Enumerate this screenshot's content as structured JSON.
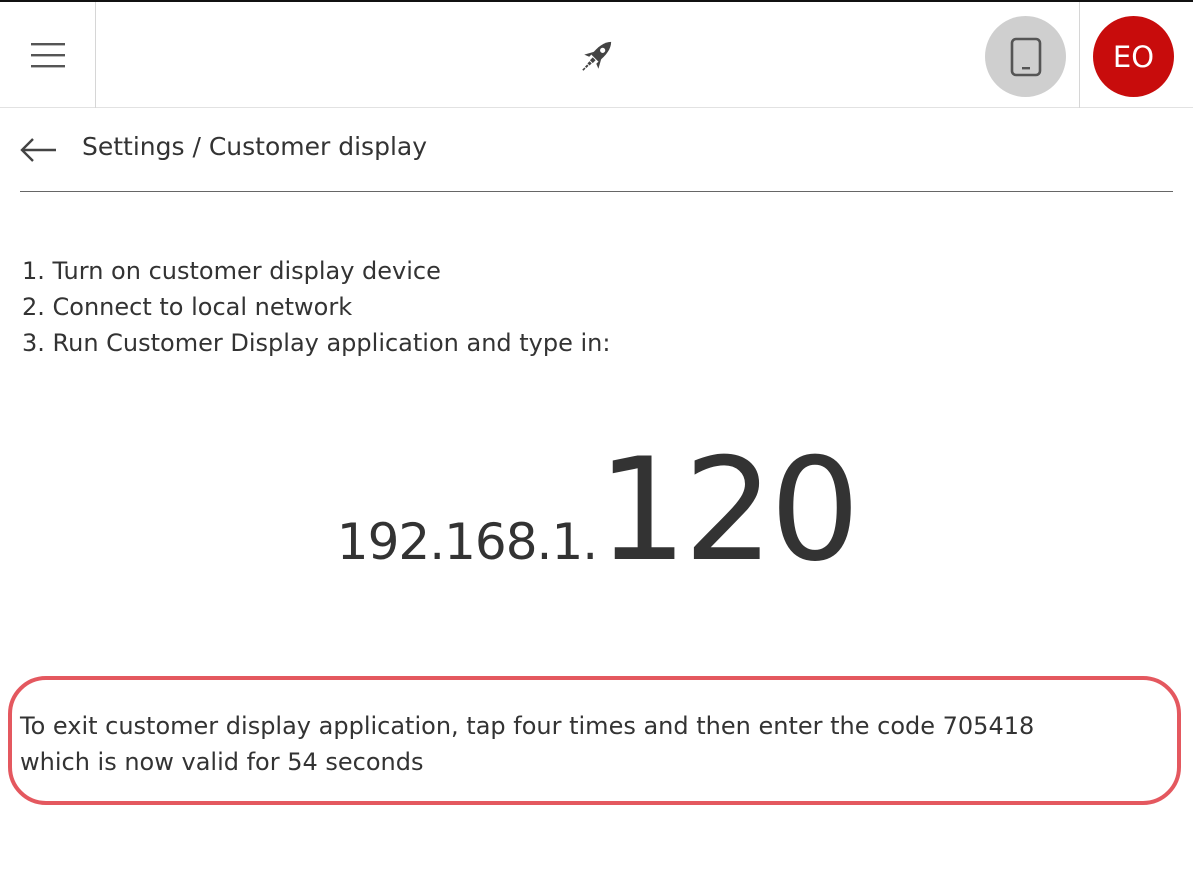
{
  "header": {
    "menu_icon": "hamburger-menu-icon",
    "logo_icon": "rocket-logo-icon",
    "device_icon": "tablet-icon",
    "user_initials": "EO",
    "avatar_color": "#c80c0c"
  },
  "breadcrumb": {
    "back_icon": "arrow-left-icon",
    "text": "Settings / Customer display"
  },
  "instructions": {
    "steps": [
      "1. Turn on customer display device",
      "2. Connect to local network",
      "3. Run Customer Display application and type in:"
    ]
  },
  "address": {
    "prefix": "192.168.1.",
    "suffix": "120"
  },
  "exit_notice": {
    "line1": "To exit customer display application, tap four times and then enter the code 705418",
    "line2": "which is now valid for 54 seconds",
    "highlight_color": "#e4585f"
  }
}
